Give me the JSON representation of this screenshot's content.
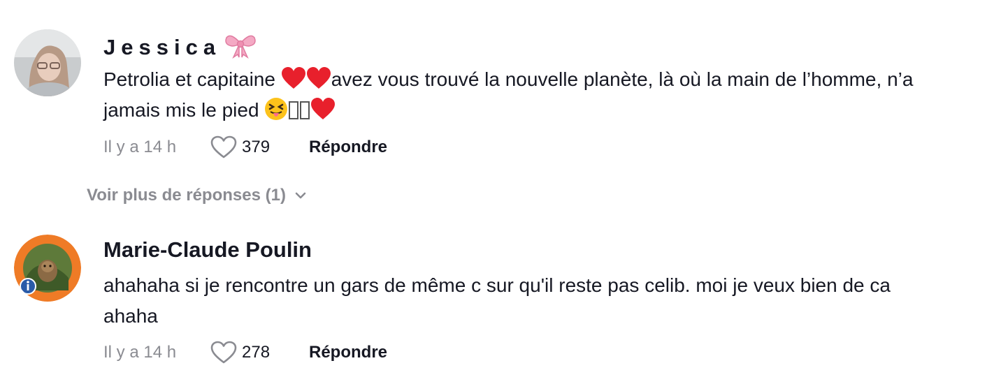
{
  "comments": [
    {
      "username": "Jessica",
      "text_part1": "Petrolia et capitaine ",
      "text_part2": "avez vous trouvé la nouvelle planète, là où la main de l’homme, n’a jamais mis le pied ",
      "time": "Il y a 14 h",
      "likes": "379",
      "reply_label": "Répondre",
      "username_emoji": "ribbon-bow-icon"
    },
    {
      "username": "Marie-Claude Poulin",
      "text": "ahahaha si je rencontre un gars de même c sur qu'il reste pas celib. moi je veux bien de ca ahaha",
      "time": "Il y a 14 h",
      "likes": "278",
      "reply_label": "Répondre"
    }
  ],
  "more_replies": "Voir plus de réponses (1)",
  "colors": {
    "primary_text": "#161823",
    "secondary_text": "#8a8b91",
    "heart_red": "#e8202c",
    "avatar_ring": "#ef7b26"
  }
}
